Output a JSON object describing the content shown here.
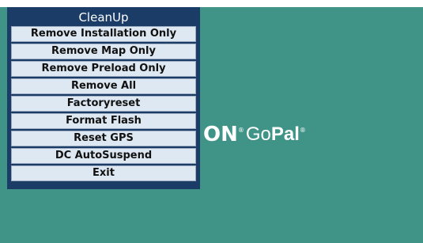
{
  "desktop": {
    "logo": {
      "brand": "ON",
      "registered": "®",
      "go": "Go",
      "pal": "Pal",
      "pal_registered": "®"
    }
  },
  "menu": {
    "title": "CleanUp",
    "items": [
      {
        "label": "Remove Installation Only"
      },
      {
        "label": "Remove Map Only"
      },
      {
        "label": "Remove Preload Only"
      },
      {
        "label": "Remove All"
      },
      {
        "label": "Factoryreset"
      },
      {
        "label": "Format Flash"
      },
      {
        "label": "Reset GPS"
      },
      {
        "label": "DC AutoSuspend"
      },
      {
        "label": "Exit"
      }
    ]
  },
  "colors": {
    "desktop_background": "#3f9487",
    "menu_background": "#1a3c66",
    "menu_item_background": "#dde8f3"
  }
}
